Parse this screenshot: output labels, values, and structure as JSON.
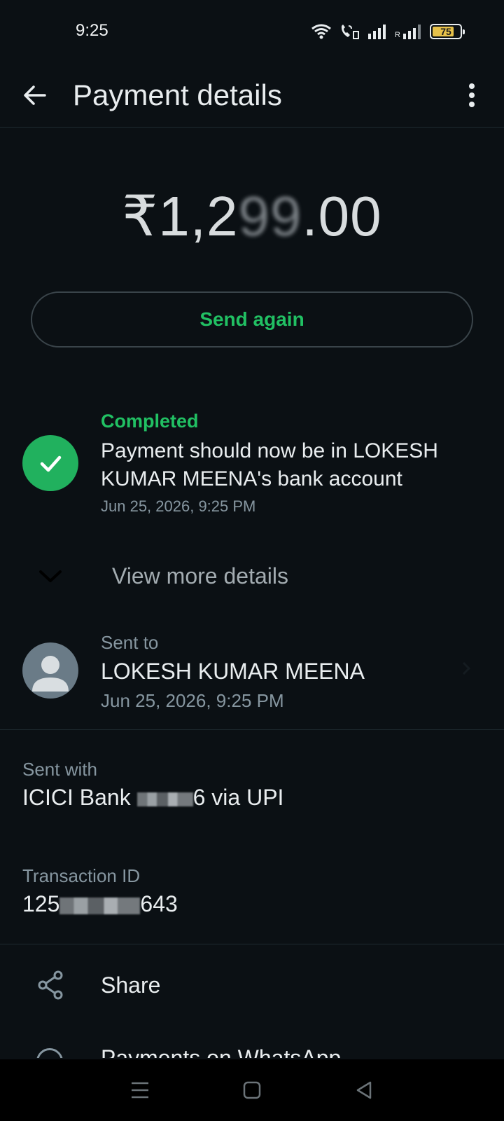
{
  "status_bar": {
    "time": "9:25",
    "battery": "75",
    "roaming_indicator": "R",
    "icons": [
      "wifi-icon",
      "volte-call-icon",
      "signal-icon",
      "signal-roaming-icon",
      "battery-icon"
    ]
  },
  "app_bar": {
    "title": "Payment details",
    "back_icon": "arrow-left-icon",
    "menu_icon": "more-vertical-icon"
  },
  "amount": {
    "prefix": "₹1,2",
    "hidden": "99",
    "suffix": ".00"
  },
  "send_again_label": "Send again",
  "payment_status": {
    "label": "Completed",
    "description": "Payment should now be in LOKESH KUMAR MEENA's bank account",
    "timestamp": "Jun 25, 2026, 9:25 PM",
    "icon": "check-icon"
  },
  "view_more_label": "View more details",
  "sent_to": {
    "label": "Sent to",
    "name": "LOKESH KUMAR MEENA",
    "timestamp": "Jun 25, 2026, 9:25 PM"
  },
  "sent_with": {
    "label": "Sent with",
    "prefix": "ICICI Bank ",
    "suffix": "6 via UPI"
  },
  "transaction": {
    "label": "Transaction ID",
    "prefix": "125",
    "suffix": "643"
  },
  "actions": {
    "share_label": "Share",
    "payments_label": "Payments on WhatsApp"
  },
  "colors": {
    "background": "#0b1014",
    "accent_green": "#21c063",
    "check_circle": "#21b15e",
    "secondary_text": "#8696a0"
  }
}
